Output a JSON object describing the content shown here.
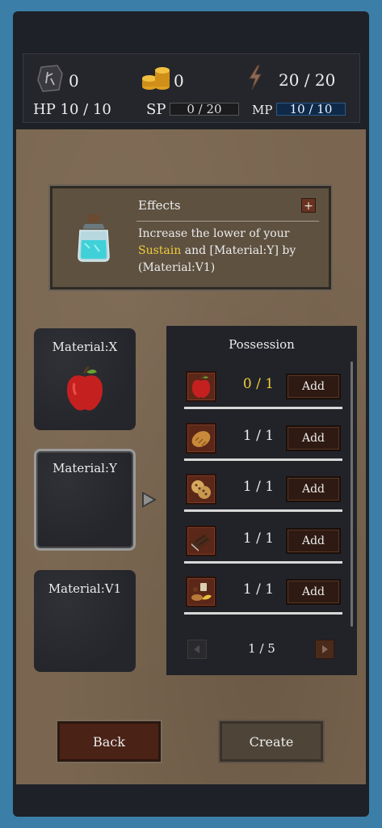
{
  "topbar": {
    "rune_count": "0",
    "gold_count": "0",
    "energy": "20 / 20",
    "hp_label": "HP",
    "hp_value": "10 / 10",
    "sp_label": "SP",
    "sp_value": "0 / 20",
    "sp_fill": 0.0,
    "mp_label": "MP",
    "mp_value": "10 / 10",
    "mp_fill": 1.0
  },
  "effects": {
    "title": "Effects",
    "plus_label": "+",
    "text_before": "Increase the lower of your ",
    "text_highlight": "Sustain",
    "text_after": " and [Material:Y] by (Material:V1)",
    "highlight_color": "#f0cc3a",
    "icon": "potion-bottle-icon"
  },
  "materials": [
    {
      "label": "Material:X",
      "icon": "apple-icon",
      "selected": false
    },
    {
      "label": "Material:Y",
      "icon": "",
      "selected": true
    },
    {
      "label": "Material:V1",
      "icon": "",
      "selected": false
    }
  ],
  "possession": {
    "title": "Possession",
    "items": [
      {
        "icon": "apple-icon",
        "count": "0 / 1",
        "add_label": "Add"
      },
      {
        "icon": "bread-icon",
        "count": "1 / 1",
        "add_label": "Add"
      },
      {
        "icon": "cookies-icon",
        "count": "1 / 1",
        "add_label": "Add"
      },
      {
        "icon": "chocolate-icon",
        "count": "1 / 1",
        "add_label": "Add"
      },
      {
        "icon": "food-assortment-icon",
        "count": "1 / 1",
        "add_label": "Add"
      }
    ],
    "page_text": "1 / 5"
  },
  "buttons": {
    "back": "Back",
    "create": "Create"
  }
}
